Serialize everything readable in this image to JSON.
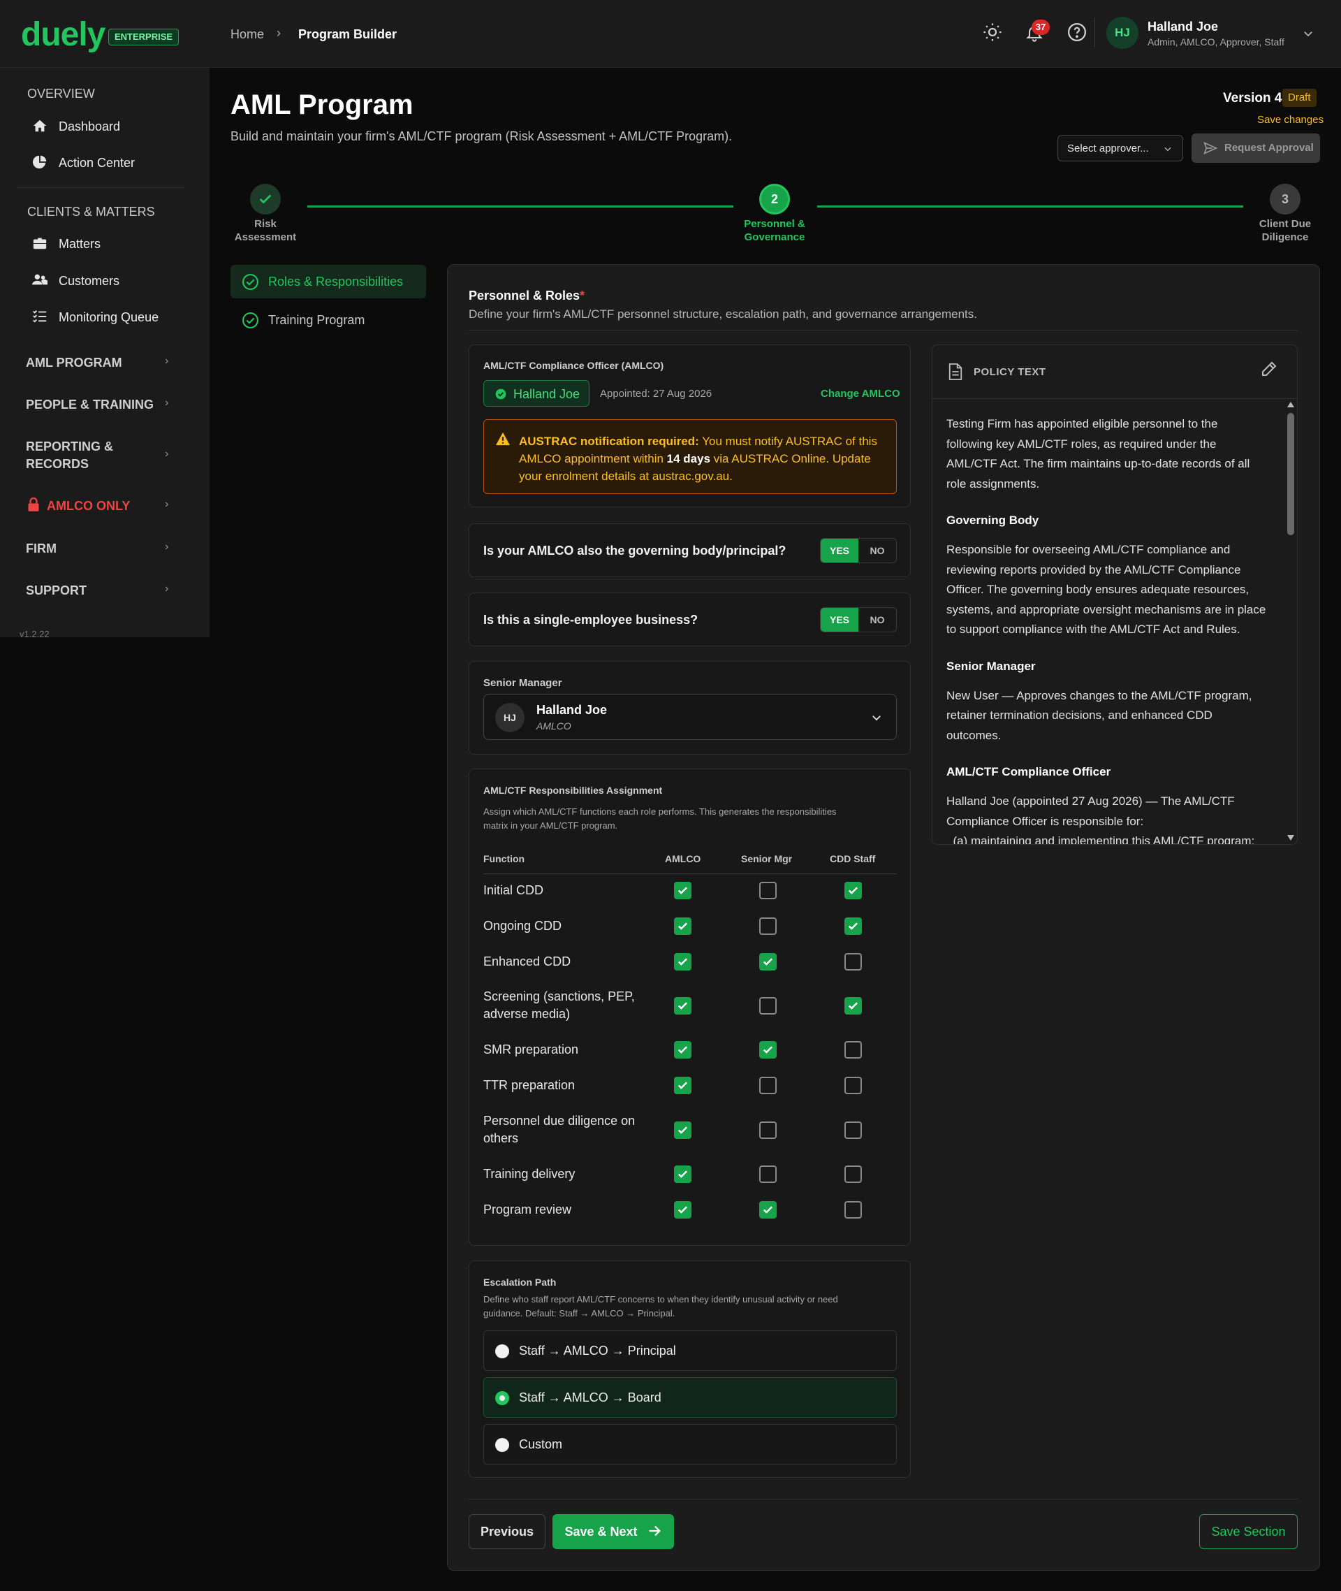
{
  "brand": {
    "logo": "duely",
    "edition": "ENTERPRISE"
  },
  "breadcrumb": {
    "home": "Home",
    "current": "Program Builder"
  },
  "header": {
    "notifications_count": "37",
    "user_initials": "HJ",
    "user_name": "Halland Joe",
    "user_roles": "Admin, AMLCO, Approver, Staff"
  },
  "sidebar": {
    "overview_heading": "OVERVIEW",
    "dashboard": "Dashboard",
    "action_center": "Action Center",
    "clients_heading": "CLIENTS & MATTERS",
    "matters": "Matters",
    "customers": "Customers",
    "monitoring_queue": "Monitoring Queue",
    "sections": [
      "AML PROGRAM",
      "PEOPLE & TRAINING",
      "REPORTING &",
      "RECORDS",
      "AMLCO ONLY",
      "FIRM",
      "SUPPORT"
    ],
    "version": "v1.2.22"
  },
  "page": {
    "title": "AML Program",
    "subtitle": "Build and maintain your firm's AML/CTF program (Risk Assessment + AML/CTF Program).",
    "version_label": "Version 4",
    "status": "Draft",
    "save_changes": "Save changes",
    "approver_placeholder": "Select approver...",
    "request_approval": "Request Approval"
  },
  "stepper": {
    "steps": [
      {
        "label_line1": "Risk",
        "label_line2": "Assessment",
        "number": ""
      },
      {
        "label_line1": "Personnel &",
        "label_line2": "Governance",
        "number": "2"
      },
      {
        "label_line1": "Client Due",
        "label_line2": "Diligence",
        "number": "3"
      }
    ]
  },
  "subnav": {
    "items": [
      "Roles & Responsibilities",
      "Training Program"
    ]
  },
  "section": {
    "title": "Personnel & Roles",
    "required": "*",
    "description": "Define your firm's AML/CTF personnel structure, escalation path, and governance arrangements."
  },
  "amlco": {
    "heading": "AML/CTF Compliance Officer (AMLCO)",
    "name": "Halland Joe",
    "appointed": "Appointed: 27 Aug 2026",
    "change": "Change AMLCO",
    "alert_bold": "AUSTRAC notification required:",
    "alert_text1": " You must notify AUSTRAC of this",
    "alert_text2a": "AMLCO appointment within ",
    "alert_days": "14 days",
    "alert_text2b": " via AUSTRAC Online. Update",
    "alert_text3": "your enrolment details at austrac.gov.au."
  },
  "questions": [
    {
      "text": "Is your AMLCO also the governing body/principal?",
      "yes": "YES",
      "no": "NO"
    },
    {
      "text": "Is this a single-employee business?",
      "yes": "YES",
      "no": "NO"
    }
  ],
  "senior_manager": {
    "label": "Senior Manager",
    "initials": "HJ",
    "name": "Halland Joe",
    "role": "AMLCO"
  },
  "responsibilities": {
    "heading": "AML/CTF Responsibilities Assignment",
    "desc1": "Assign which AML/CTF functions each role performs. This generates the responsibilities",
    "desc2": "matrix in your AML/CTF program.",
    "columns": [
      "Function",
      "AMLCO",
      "Senior Mgr",
      "CDD Staff"
    ],
    "rows": [
      {
        "name": [
          "Initial CDD"
        ],
        "checks": [
          true,
          false,
          true
        ]
      },
      {
        "name": [
          "Ongoing CDD"
        ],
        "checks": [
          true,
          false,
          true
        ]
      },
      {
        "name": [
          "Enhanced CDD"
        ],
        "checks": [
          true,
          true,
          false
        ]
      },
      {
        "name": [
          "Screening (sanctions, PEP,",
          "adverse media)"
        ],
        "checks": [
          true,
          false,
          true
        ]
      },
      {
        "name": [
          "SMR preparation"
        ],
        "checks": [
          true,
          true,
          false
        ]
      },
      {
        "name": [
          "TTR preparation"
        ],
        "checks": [
          true,
          false,
          false
        ]
      },
      {
        "name": [
          "Personnel due diligence on",
          "others"
        ],
        "checks": [
          true,
          false,
          false
        ]
      },
      {
        "name": [
          "Training delivery"
        ],
        "checks": [
          true,
          false,
          false
        ]
      },
      {
        "name": [
          "Program review"
        ],
        "checks": [
          true,
          true,
          false
        ]
      }
    ]
  },
  "escalation": {
    "heading": "Escalation Path",
    "desc1": "Define who staff report AML/CTF concerns to when they identify unusual activity or need",
    "desc2": "guidance. Default: Staff → AMLCO → Principal.",
    "options": [
      "Staff → AMLCO → Principal",
      "Staff → AMLCO → Board",
      "Custom"
    ],
    "selected_index": 1
  },
  "policy": {
    "heading": "POLICY TEXT",
    "p1": [
      "Testing Firm has appointed eligible personnel to the",
      "following key AML/CTF roles, as required under the",
      "AML/CTF Act. The firm maintains up-to-date records of all",
      "role assignments."
    ],
    "h2": "Governing Body",
    "p2": [
      "Responsible for overseeing AML/CTF compliance and",
      "reviewing reports provided by the AML/CTF Compliance",
      "Officer. The governing body ensures adequate resources,",
      "systems, and appropriate oversight mechanisms are in place",
      "to support compliance with the AML/CTF Act and Rules."
    ],
    "h3": "Senior Manager",
    "p3": [
      "New User — Approves changes to the AML/CTF program,",
      "retainer termination decisions, and enhanced CDD",
      "outcomes."
    ],
    "h4": "AML/CTF Compliance Officer",
    "p4": [
      "Halland Joe (appointed 27 Aug 2026) — The AML/CTF",
      "Compliance Officer is responsible for:",
      "  (a) maintaining and implementing this AML/CTF program;"
    ]
  },
  "footer": {
    "previous": "Previous",
    "save_next": "Save & Next",
    "save_section": "Save Section"
  },
  "colors": {
    "accent": "#22c55e",
    "brand_green": "#16a34a",
    "warning": "#f59e0b",
    "danger": "#ef4444"
  }
}
